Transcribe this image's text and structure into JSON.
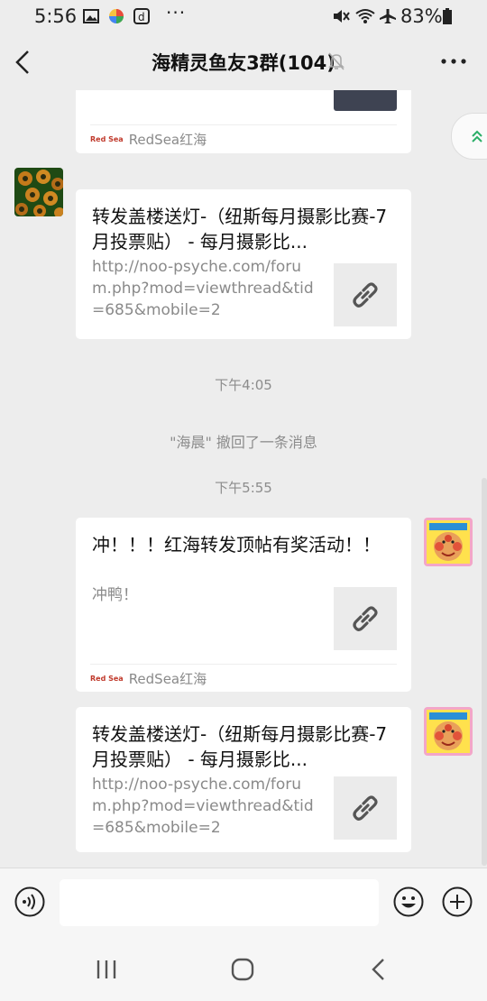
{
  "status_bar": {
    "time": "5:56",
    "dots": "···",
    "battery": "83%"
  },
  "header": {
    "title": "海精灵鱼友3群(104)"
  },
  "messages": {
    "top_card_source": "RedSea红海",
    "card1": {
      "title": "转发盖楼送灯-（纽斯每月摄影比赛-7月投票贴） - 每月摄影比...",
      "desc": "http://noo-psyche.com/forum.php?mod=viewthread&tid=685&mobile=2"
    },
    "time1": "下午4:05",
    "recall": "\"海晨\" 撤回了一条消息",
    "time2": "下午5:55",
    "card2": {
      "title": "冲！！！红海转发顶帖有奖活动！！",
      "desc": "冲鸭！",
      "source": "RedSea红海"
    },
    "card3": {
      "title": "转发盖楼送灯-（纽斯每月摄影比赛-7月投票贴） - 每月摄影比...",
      "desc": "http://noo-psyche.com/forum.php?mod=viewthread&tid=685&mobile=2"
    }
  },
  "source_logo_text": "Red Sea",
  "icons": [
    "back-arrow-icon",
    "mute-bell-icon",
    "more-icon",
    "link-icon",
    "voice-icon",
    "emoji-icon",
    "plus-icon",
    "recent-apps-icon",
    "home-icon",
    "back-nav-icon",
    "scroll-up-icon"
  ],
  "colors": {
    "background": "#ededed",
    "card": "#ffffff",
    "muted_text": "#8a8a8a"
  }
}
